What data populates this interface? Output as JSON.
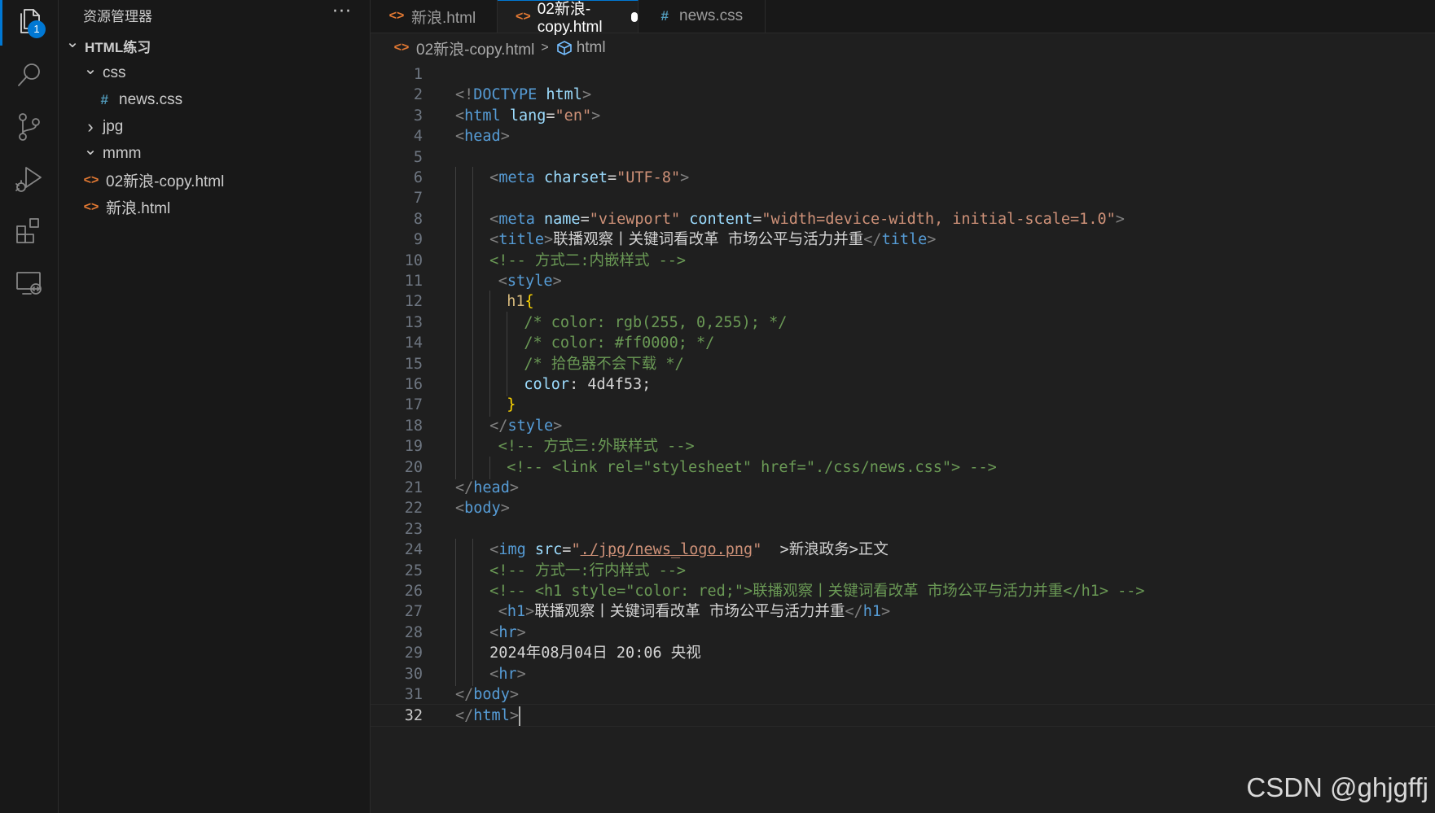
{
  "activity_bar": {
    "explorer_badge": "1",
    "items": [
      "files-icon",
      "search-icon",
      "source-control-icon",
      "run-debug-icon",
      "extensions-icon",
      "remote-explorer-icon"
    ]
  },
  "sidebar": {
    "title": "资源管理器",
    "more_label": "···",
    "tree": [
      {
        "label": "HTML练习",
        "type": "folder-root",
        "expanded": true
      },
      {
        "label": "css",
        "type": "folder",
        "expanded": true
      },
      {
        "label": "news.css",
        "type": "css"
      },
      {
        "label": "jpg",
        "type": "folder",
        "expanded": false
      },
      {
        "label": "mmm",
        "type": "folder",
        "expanded": true
      },
      {
        "label": "02新浪-copy.html",
        "type": "html"
      },
      {
        "label": "新浪.html",
        "type": "html"
      }
    ]
  },
  "tabs": [
    {
      "label": "新浪.html",
      "type": "html",
      "active": false
    },
    {
      "label": "02新浪-copy.html",
      "type": "html",
      "active": true,
      "dirty": true
    },
    {
      "label": "news.css",
      "type": "css",
      "active": false
    }
  ],
  "breadcrumb": {
    "file": "02新浪-copy.html",
    "symbol": "html"
  },
  "editor": {
    "current_line": 32,
    "lines": [
      {
        "n": "1",
        "indent": 0,
        "t": []
      },
      {
        "n": "2",
        "indent": 0,
        "t": [
          [
            "p",
            "<!"
          ],
          [
            "k",
            "DOCTYPE "
          ],
          [
            "a",
            "html"
          ],
          [
            "p",
            ">"
          ]
        ]
      },
      {
        "n": "3",
        "indent": 0,
        "t": [
          [
            "p",
            "<"
          ],
          [
            "k",
            "html "
          ],
          [
            "a",
            "lang"
          ],
          [
            "w",
            "="
          ],
          [
            "s",
            "\"en\""
          ],
          [
            "p",
            ">"
          ]
        ]
      },
      {
        "n": "4",
        "indent": 0,
        "t": [
          [
            "p",
            "<"
          ],
          [
            "k",
            "head"
          ],
          [
            "p",
            ">"
          ]
        ]
      },
      {
        "n": "5",
        "indent": 0,
        "t": []
      },
      {
        "n": "6",
        "indent": 4,
        "t": [
          [
            "p",
            "<"
          ],
          [
            "k",
            "meta "
          ],
          [
            "a",
            "charset"
          ],
          [
            "w",
            "="
          ],
          [
            "s",
            "\"UTF-8\""
          ],
          [
            "p",
            ">"
          ]
        ]
      },
      {
        "n": "7",
        "indent": 4,
        "t": []
      },
      {
        "n": "8",
        "indent": 4,
        "t": [
          [
            "p",
            "<"
          ],
          [
            "k",
            "meta "
          ],
          [
            "a",
            "name"
          ],
          [
            "w",
            "="
          ],
          [
            "s",
            "\"viewport\" "
          ],
          [
            "a",
            "content"
          ],
          [
            "w",
            "="
          ],
          [
            "s",
            "\"width=device-width, initial-scale=1.0\""
          ],
          [
            "p",
            ">"
          ]
        ]
      },
      {
        "n": "9",
        "indent": 4,
        "t": [
          [
            "p",
            "<"
          ],
          [
            "k",
            "title"
          ],
          [
            "p",
            ">"
          ],
          [
            "w",
            "联播观察丨关键词看改革 市场公平与活力并重"
          ],
          [
            "p",
            "</"
          ],
          [
            "k",
            "title"
          ],
          [
            "p",
            ">"
          ]
        ]
      },
      {
        "n": "10",
        "indent": 4,
        "t": [
          [
            "c",
            "<!-- 方式二:内嵌样式 -->"
          ]
        ]
      },
      {
        "n": "11",
        "indent": 5,
        "t": [
          [
            "p",
            "<"
          ],
          [
            "k",
            "style"
          ],
          [
            "p",
            ">"
          ]
        ]
      },
      {
        "n": "12",
        "indent": 6,
        "t": [
          [
            "sel",
            "h1"
          ],
          [
            "br",
            "{"
          ]
        ]
      },
      {
        "n": "13",
        "indent": 8,
        "t": [
          [
            "c",
            "/* color: rgb(255, 0,255); */"
          ]
        ]
      },
      {
        "n": "14",
        "indent": 8,
        "t": [
          [
            "c",
            "/* color: #ff0000; */"
          ]
        ]
      },
      {
        "n": "15",
        "indent": 8,
        "t": [
          [
            "c",
            "/* 拾色器不会下载 */"
          ]
        ]
      },
      {
        "n": "16",
        "indent": 8,
        "t": [
          [
            "a",
            "color"
          ],
          [
            "w",
            ": "
          ],
          [
            "n",
            "4d4f53"
          ],
          [
            "w",
            ";"
          ]
        ]
      },
      {
        "n": "17",
        "indent": 6,
        "t": [
          [
            "br",
            "}"
          ]
        ]
      },
      {
        "n": "18",
        "indent": 4,
        "t": [
          [
            "p",
            "</"
          ],
          [
            "k",
            "style"
          ],
          [
            "p",
            ">"
          ]
        ]
      },
      {
        "n": "19",
        "indent": 5,
        "t": [
          [
            "c",
            "<!-- 方式三:外联样式 -->"
          ]
        ]
      },
      {
        "n": "20",
        "indent": 6,
        "t": [
          [
            "c",
            "<!-- <link rel=\"stylesheet\" href=\"./css/news.css\"> -->"
          ]
        ]
      },
      {
        "n": "21",
        "indent": 0,
        "t": [
          [
            "p",
            "</"
          ],
          [
            "k",
            "head"
          ],
          [
            "p",
            ">"
          ]
        ]
      },
      {
        "n": "22",
        "indent": 0,
        "t": [
          [
            "p",
            "<"
          ],
          [
            "k",
            "body"
          ],
          [
            "p",
            ">"
          ]
        ]
      },
      {
        "n": "23",
        "indent": 0,
        "t": []
      },
      {
        "n": "24",
        "indent": 4,
        "t": [
          [
            "p",
            "<"
          ],
          [
            "k",
            "img "
          ],
          [
            "a",
            "src"
          ],
          [
            "w",
            "="
          ],
          [
            "s",
            "\""
          ],
          [
            "su",
            "./jpg/news_logo.png"
          ],
          [
            "s",
            "\""
          ],
          [
            "w",
            "  >新浪政务>正文"
          ]
        ]
      },
      {
        "n": "25",
        "indent": 4,
        "t": [
          [
            "c",
            "<!-- 方式一:行内样式 -->"
          ]
        ]
      },
      {
        "n": "26",
        "indent": 4,
        "t": [
          [
            "c",
            "<!-- <h1 style=\"color: red;\">联播观察丨关键词看改革 市场公平与活力并重</h1> -->"
          ]
        ]
      },
      {
        "n": "27",
        "indent": 5,
        "t": [
          [
            "p",
            "<"
          ],
          [
            "k",
            "h1"
          ],
          [
            "p",
            ">"
          ],
          [
            "w",
            "联播观察丨关键词看改革 市场公平与活力并重"
          ],
          [
            "p",
            "</"
          ],
          [
            "k",
            "h1"
          ],
          [
            "p",
            ">"
          ]
        ]
      },
      {
        "n": "28",
        "indent": 4,
        "t": [
          [
            "p",
            "<"
          ],
          [
            "k",
            "hr"
          ],
          [
            "p",
            ">"
          ]
        ]
      },
      {
        "n": "29",
        "indent": 4,
        "t": [
          [
            "w",
            "2024年08月04日 20:06 央视"
          ]
        ]
      },
      {
        "n": "30",
        "indent": 4,
        "t": [
          [
            "p",
            "<"
          ],
          [
            "k",
            "hr"
          ],
          [
            "p",
            ">"
          ]
        ]
      },
      {
        "n": "31",
        "indent": 0,
        "t": [
          [
            "p",
            "</"
          ],
          [
            "k",
            "body"
          ],
          [
            "p",
            ">"
          ]
        ]
      },
      {
        "n": "32",
        "indent": 0,
        "t": [
          [
            "p",
            "</"
          ],
          [
            "k",
            "html"
          ],
          [
            "p",
            ">"
          ]
        ]
      }
    ]
  },
  "watermark": "CSDN @ghjgffj",
  "colors": {
    "accent": "#0078d4",
    "punct": "#808080",
    "tag": "#569cd6",
    "attr": "#9cdcfe",
    "string": "#ce9178",
    "comment": "#6a9955",
    "text": "#d4d4d4",
    "selector": "#d7ba7d",
    "bracket": "#ffd700",
    "number": "#d4d4d4"
  }
}
